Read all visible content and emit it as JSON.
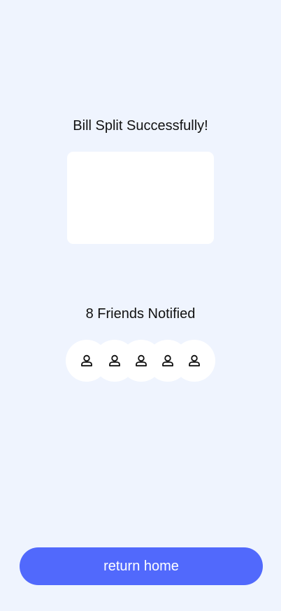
{
  "success": {
    "title": "Bill Split Successfully!"
  },
  "friends": {
    "title": "8 Friends Notified",
    "avatars": [
      {
        "icon": "person-icon"
      },
      {
        "icon": "person-icon"
      },
      {
        "icon": "person-icon"
      },
      {
        "icon": "person-icon"
      },
      {
        "icon": "person-icon"
      }
    ]
  },
  "actions": {
    "return_label": "return home"
  },
  "colors": {
    "background": "#eff4fe",
    "card": "#ffffff",
    "accent": "#5169fc",
    "text": "#111111"
  }
}
